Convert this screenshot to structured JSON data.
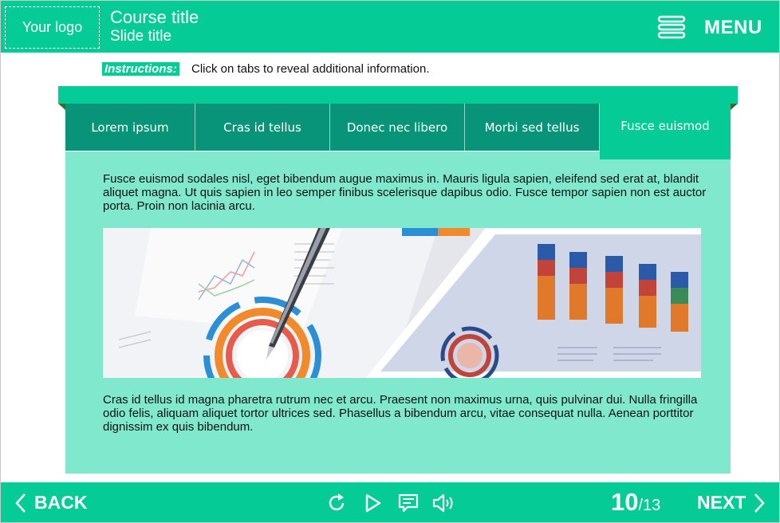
{
  "header": {
    "logo": "Your logo",
    "course_title": "Course title",
    "slide_title": "Slide title",
    "menu_label": "MENU",
    "menu_icon": "stack-menu-icon"
  },
  "instructions": {
    "tag": "Instructions:",
    "text": "Click on tabs to reveal additional information."
  },
  "tabs": [
    {
      "label": "Lorem ipsum",
      "active": false
    },
    {
      "label": "Cras id tellus",
      "active": false
    },
    {
      "label": "Donec nec libero",
      "active": false
    },
    {
      "label": "Morbi sed tellus",
      "active": false
    },
    {
      "label": "Fusce euismod",
      "active": true
    }
  ],
  "content": {
    "paragraph1": "Fusce euismod sodales nisl, eget bibendum augue maximus in. Mauris ligula sapien, eleifend sed erat at, blandit aliquet magna. Ut quis sapien in leo semper finibus scelerisque dapibus odio. Fusce tempor sapien non est auctor porta. Proin non lacinia arcu.",
    "paragraph2": "Cras id tellus id magna pharetra rutrum nec et arcu. Praesent non maximus urna, quis pulvinar dui. Nulla fringilla odio felis, aliquam aliquet tortor ultrices sed. Phasellus a bibendum arcu, vitae consequat nulla. Aenean porttitor dignissim ex quis bibendum.",
    "image": "business-charts-tablet-pen-photo"
  },
  "footer": {
    "back_label": "BACK",
    "next_label": "NEXT",
    "current_page": "10",
    "total_pages": "/13",
    "icons": [
      "replay-icon",
      "play-icon",
      "transcript-icon",
      "volume-icon"
    ]
  },
  "colors": {
    "brand": "#05cc96",
    "tab_inactive": "#089478",
    "panel": "#7fe8cd"
  }
}
